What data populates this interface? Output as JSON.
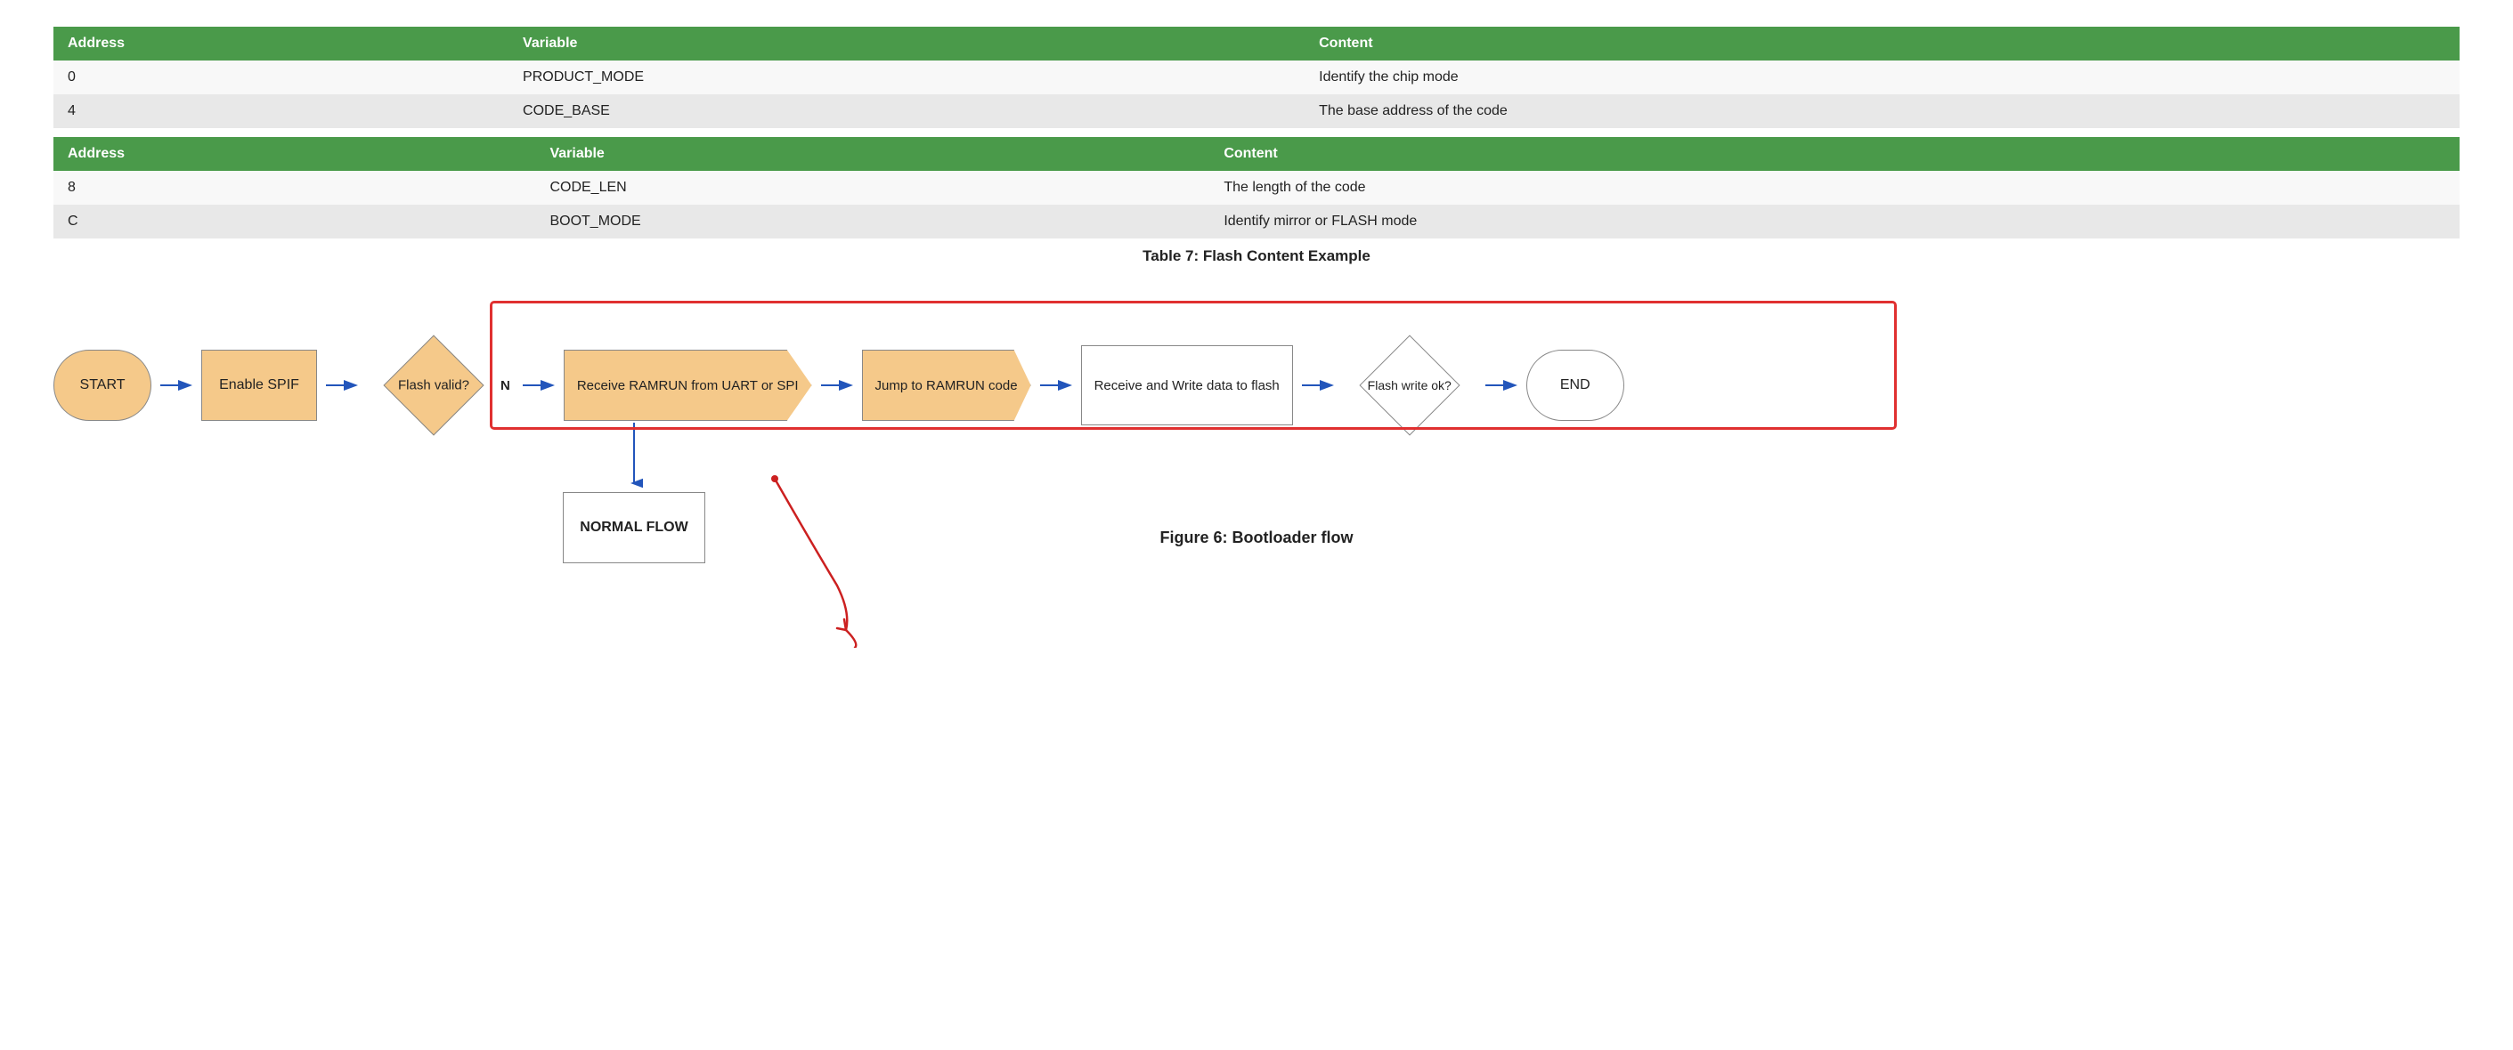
{
  "table1": {
    "headers": [
      "Address",
      "Variable",
      "Content"
    ],
    "rows": [
      [
        "0",
        "PRODUCT_MODE",
        "Identify the chip mode"
      ],
      [
        "4",
        "CODE_BASE",
        "The base address of the code"
      ]
    ]
  },
  "table2": {
    "headers": [
      "Address",
      "Variable",
      "Content"
    ],
    "rows": [
      [
        "8",
        "CODE_LEN",
        "The length of the code"
      ],
      [
        "C",
        "BOOT_MODE",
        "Identify mirror or FLASH mode"
      ]
    ]
  },
  "table_caption": "Table 7: Flash Content Example",
  "flowchart": {
    "nodes": {
      "start": "START",
      "enable_spif": "Enable SPIF",
      "flash_valid": "Flash valid?",
      "flash_valid_n": "N",
      "receive_ramrun": "Receive RAMRUN from UART or SPI",
      "jump_ramrun": "Jump to RAMRUN code",
      "receive_write": "Receive and Write data to flash",
      "flash_write_ok": "Flash write ok?",
      "end": "END",
      "normal_flow": "NORMAL FLOW"
    }
  },
  "figure_caption": "Figure 6: Bootloader flow",
  "colors": {
    "table_header": "#4a9a4a",
    "shape_fill": "#f5c98a",
    "arrow_color": "#2255bb",
    "red_border": "#e03030"
  }
}
